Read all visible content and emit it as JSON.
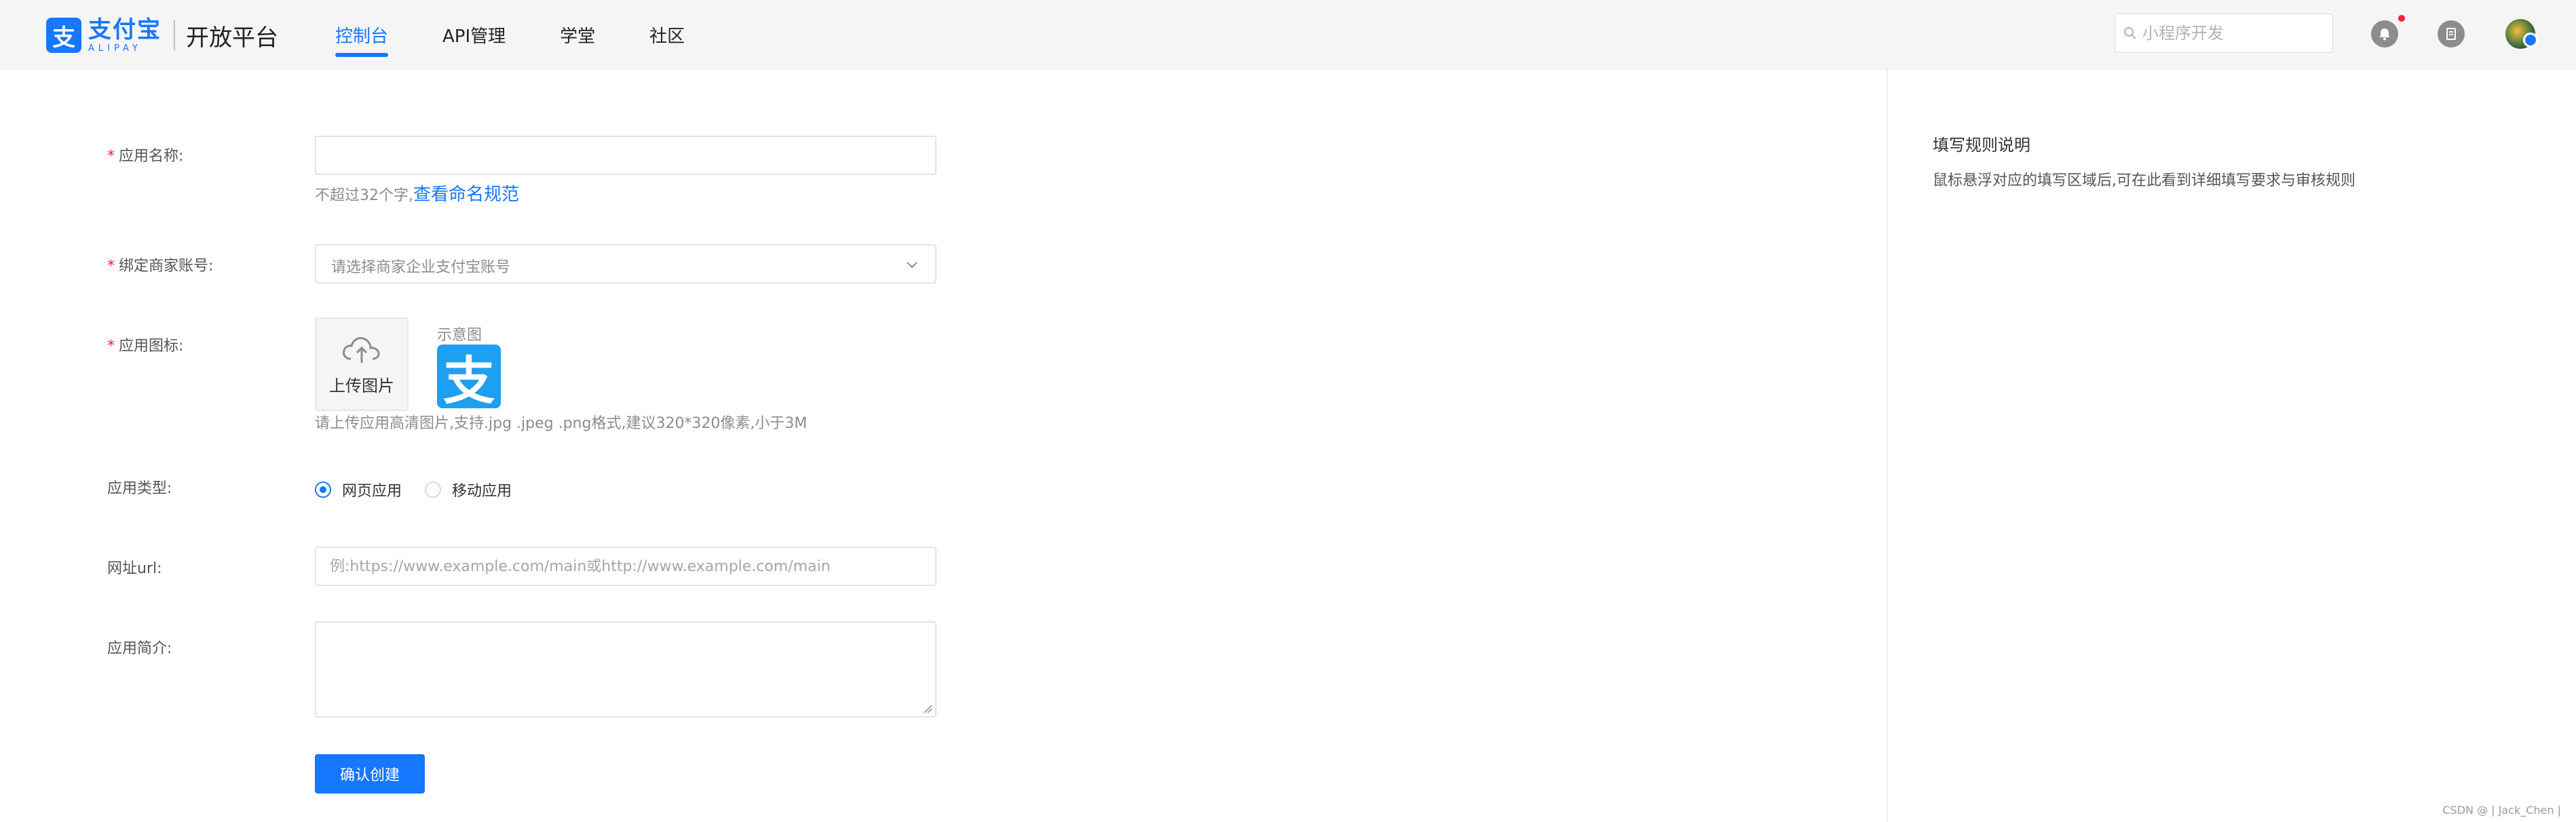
{
  "header": {
    "logo_cn": "支付宝",
    "logo_en": "ALIPAY",
    "platform": "开放平台",
    "nav": [
      "控制台",
      "API管理",
      "学堂",
      "社区"
    ],
    "search_placeholder": "小程序开发"
  },
  "form": {
    "app_name": {
      "label": "应用名称:",
      "hint": "不超过32个字,",
      "link": "查看命名规范",
      "value": ""
    },
    "merchant": {
      "label": "绑定商家账号:",
      "placeholder": "请选择商家企业支付宝账号"
    },
    "icon": {
      "label": "应用图标:",
      "upload_label": "上传图片",
      "sample_label": "示意图",
      "sample_glyph": "支",
      "hint": "请上传应用高清图片,支持.jpg .jpeg .png格式,建议320*320像素,小于3M"
    },
    "app_type": {
      "label": "应用类型:",
      "options": [
        "网页应用",
        "移动应用"
      ],
      "selected": "网页应用"
    },
    "url": {
      "label": "网址url:",
      "placeholder": "例:https://www.example.com/main或http://www.example.com/main"
    },
    "intro": {
      "label": "应用简介:",
      "value": ""
    },
    "submit_label": "确认创建"
  },
  "side": {
    "title": "填写规则说明",
    "text": "鼠标悬浮对应的填写区域后,可在此看到详细填写要求与审核规则"
  },
  "footer": "CSDN @ | Jack_Chen |",
  "colors": {
    "accent": "#1677ff",
    "required": "#f5222d",
    "header_bg": "#f5f5f5"
  }
}
